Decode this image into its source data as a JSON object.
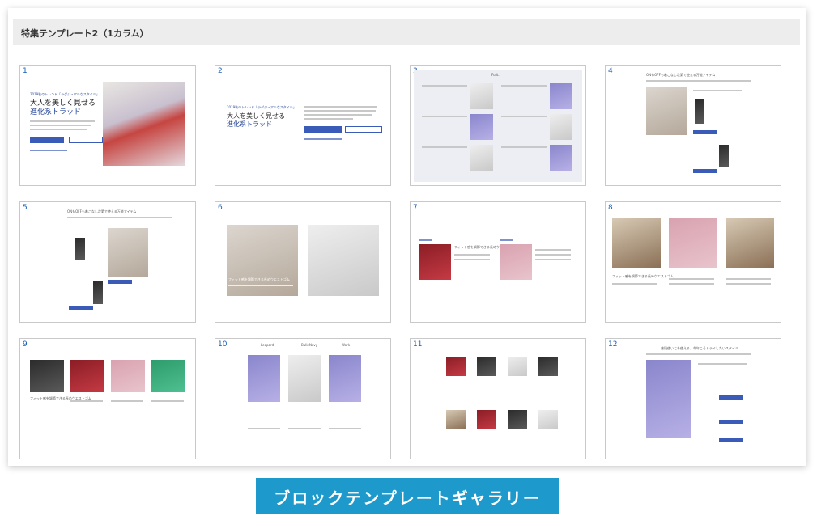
{
  "panel": {
    "title": "特集テンプレート2（1カラム）"
  },
  "banner": {
    "text": "ブロックテンプレートギャラリー"
  },
  "thumb1": {
    "number": "1",
    "kicker": "2019秋のトレンド「ラグジュアルなスタイル」",
    "title_line1": "大人を美しく見せる",
    "title_line2": "進化系トラッド"
  },
  "thumb2": {
    "number": "2",
    "kicker": "2019秋のトレンド「ラグジュアルなスタイル」",
    "title_line1": "大人を美しく見せる",
    "title_line2": "進化系トラッド"
  },
  "thumb3": {
    "number": "3",
    "header": "Fullt."
  },
  "thumb4": {
    "number": "4",
    "heading": "ONもOFFも着こなし次第で使える万能アイテム"
  },
  "thumb5": {
    "number": "5",
    "heading": "ONもOFFも着こなし次第で使える万能アイテム"
  },
  "thumb6": {
    "number": "6",
    "caption": "フィット感を調節できる長めウエストゴム"
  },
  "thumb7": {
    "number": "7",
    "caption": "フィット感を調節できる長めウエストゴム"
  },
  "thumb8": {
    "number": "8",
    "caption": "フィット感を調節できる長めウエストゴム"
  },
  "thumb9": {
    "number": "9",
    "caption": "フィット感を調節できる長めウエストゴム"
  },
  "thumb10": {
    "number": "10",
    "col1": "Leopard",
    "col2": "Bulk Navy",
    "col3": "Work"
  },
  "thumb11": {
    "number": "11"
  },
  "thumb12": {
    "number": "12",
    "heading": "普段使いにも使える、今年こそトライしたいスタイル"
  }
}
